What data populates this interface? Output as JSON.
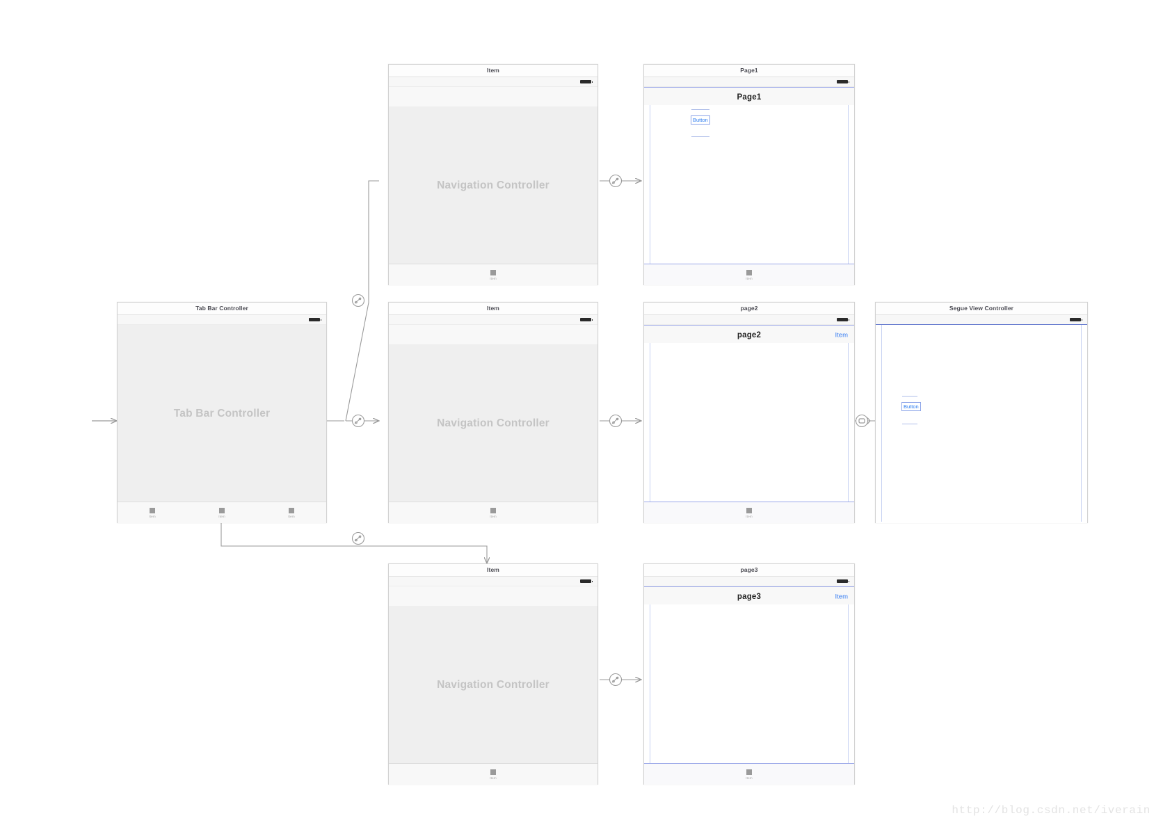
{
  "canvas": {
    "background": "#ffffff",
    "watermark": "http://blog.csdn.net/iverain"
  },
  "colors": {
    "scene_border": "#d2d2d2",
    "placeholder_fill": "#efefef",
    "placeholder_text": "#c4c4c4",
    "selection_blue": "#6b7fd0",
    "guide_blue": "#c7d2f2",
    "tint_blue": "#3a7ff2",
    "connector_gray": "#9a9a9a"
  },
  "scenes": {
    "tab_bar_controller": {
      "title": "Tab Bar Controller",
      "placeholder_label": "Tab Bar Controller",
      "tab_items": [
        {
          "label": "Item"
        },
        {
          "label": "Item"
        },
        {
          "label": "Item"
        }
      ]
    },
    "nav_controller_1": {
      "title": "Item",
      "placeholder_label": "Navigation Controller",
      "tab_items": [
        {
          "label": "Item"
        }
      ]
    },
    "nav_controller_2": {
      "title": "Item",
      "placeholder_label": "Navigation Controller",
      "tab_items": [
        {
          "label": "Item"
        }
      ]
    },
    "nav_controller_3": {
      "title": "Item",
      "placeholder_label": "Navigation Controller",
      "tab_items": [
        {
          "label": "Item"
        }
      ]
    },
    "page1": {
      "title": "Page1",
      "nav_title": "Page1",
      "nav_right_item": "",
      "button_label": "Button",
      "tab_items": [
        {
          "label": "Item"
        }
      ]
    },
    "page2": {
      "title": "page2",
      "nav_title": "page2",
      "nav_right_item": "Item",
      "button_label": "",
      "tab_items": [
        {
          "label": "Item"
        }
      ]
    },
    "page3": {
      "title": "page3",
      "nav_title": "page3",
      "nav_right_item": "Item",
      "button_label": "",
      "tab_items": [
        {
          "label": "Item"
        }
      ]
    },
    "segue_view_controller": {
      "title": "Segue View Controller",
      "button_label": "Button"
    }
  },
  "connectors": {
    "initial_arrow": "initial-view-controller-arrow",
    "relationship_segue": "relationship-segue",
    "show_segue": "show-segue",
    "present_modally_segue": "present-modally-segue"
  }
}
